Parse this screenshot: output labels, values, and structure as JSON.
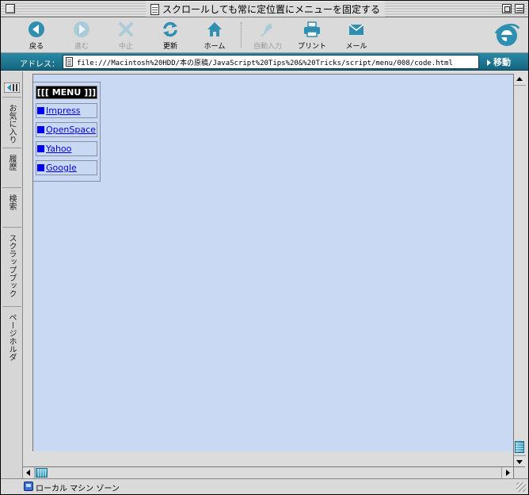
{
  "window": {
    "title": "スクロールしても常に定位置にメニューを固定する"
  },
  "toolbar": {
    "buttons": [
      {
        "label": "戻る",
        "icon": "back-arrow-icon",
        "enabled": true
      },
      {
        "label": "進む",
        "icon": "forward-arrow-icon",
        "enabled": false
      },
      {
        "label": "中止",
        "icon": "stop-x-icon",
        "enabled": false
      },
      {
        "label": "更新",
        "icon": "refresh-icon",
        "enabled": true
      },
      {
        "label": "ホーム",
        "icon": "home-icon",
        "enabled": true
      },
      {
        "label": "自動入力",
        "icon": "autofill-icon",
        "enabled": false
      },
      {
        "label": "プリント",
        "icon": "printer-icon",
        "enabled": true
      },
      {
        "label": "メール",
        "icon": "mail-icon",
        "enabled": true
      }
    ]
  },
  "address": {
    "label": "アドレス：",
    "url": "file:///Macintosh%20HDD/本の原稿/JavaScript%20Tips%20&%20Tricks/script/menu/008/code.html",
    "go_label": "移動"
  },
  "explorer_bar": {
    "tabs": [
      "お気に入り",
      "履歴",
      "検索",
      "スクラップブック",
      "ページホルダ"
    ]
  },
  "page": {
    "menu": {
      "title": "[[[ MENU ]]]",
      "items": [
        "Impress",
        "OpenSpace",
        "Yahoo",
        "Google"
      ]
    }
  },
  "status": {
    "zone": "ローカル マシン ゾーン"
  },
  "colors": {
    "content_background": "#cad9f3",
    "link": "#0000ee",
    "address_bar": "#1f7a96",
    "accent": "#2f8fb0"
  }
}
